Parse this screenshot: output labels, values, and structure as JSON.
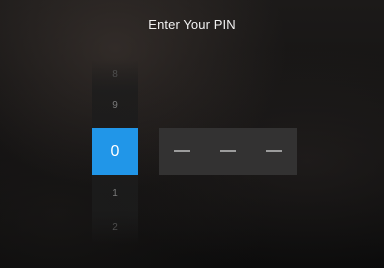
{
  "header": {
    "title": "Enter Your PIN"
  },
  "pin": {
    "active_index": 0,
    "digits": [
      "0",
      "—",
      "—",
      "—"
    ],
    "picker_above": [
      "8",
      "9"
    ],
    "picker_below": [
      "1",
      "2"
    ]
  },
  "colors": {
    "active_box": "#2196e8",
    "inactive_box": "#333232",
    "text": "#f2f2f2"
  }
}
